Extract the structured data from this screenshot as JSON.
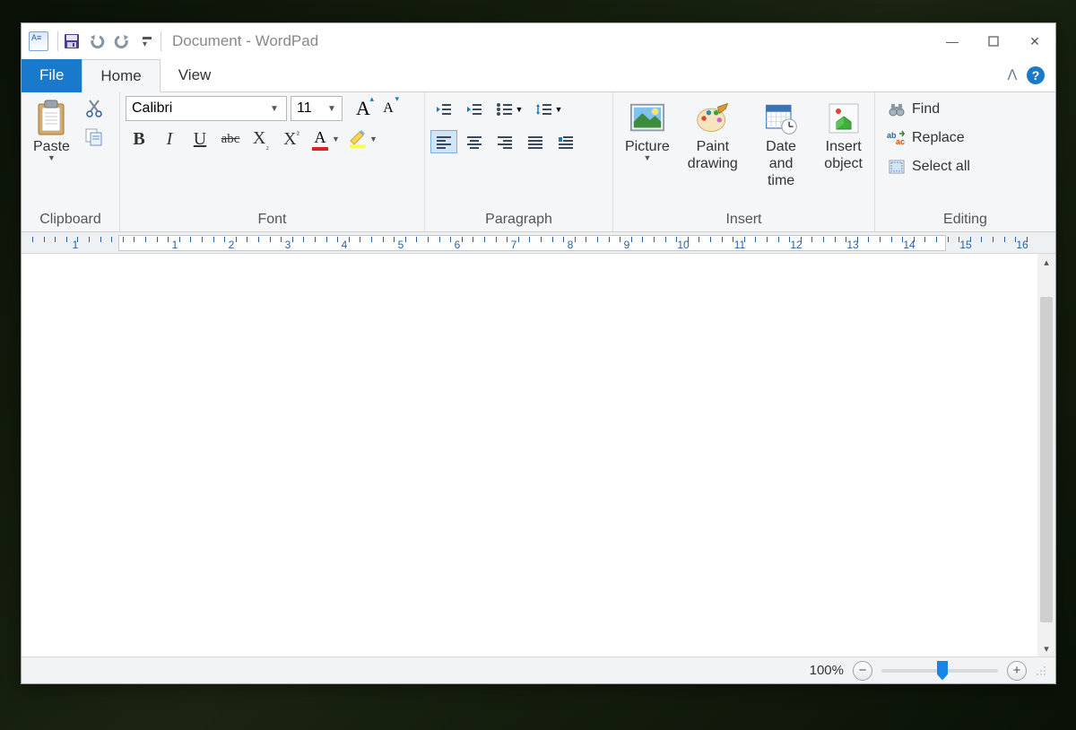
{
  "title": "Document - WordPad",
  "tabs": {
    "file": "File",
    "home": "Home",
    "view": "View"
  },
  "clipboard": {
    "paste": "Paste",
    "group": "Clipboard"
  },
  "font": {
    "name": "Calibri",
    "size": "11",
    "group": "Font"
  },
  "paragraph": {
    "group": "Paragraph"
  },
  "insert": {
    "picture": "Picture",
    "paint": "Paint\ndrawing",
    "datetime": "Date and\ntime",
    "object": "Insert\nobject",
    "group": "Insert"
  },
  "editing": {
    "find": "Find",
    "replace": "Replace",
    "selectall": "Select all",
    "group": "Editing"
  },
  "ruler_numbers": [
    "1",
    "1",
    "2",
    "3",
    "4",
    "5",
    "6",
    "7",
    "8",
    "9",
    "10",
    "11",
    "12",
    "13",
    "14",
    "15",
    "16"
  ],
  "status": {
    "zoom": "100%"
  }
}
